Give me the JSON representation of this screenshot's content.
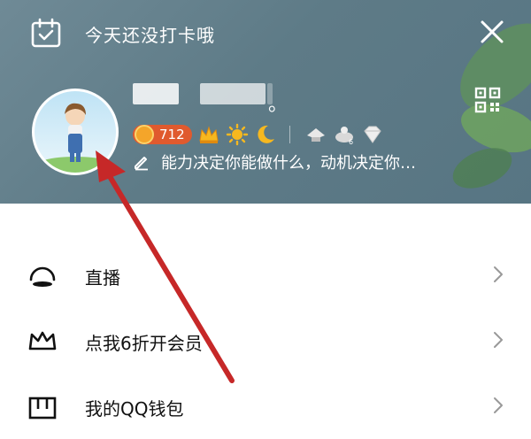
{
  "header": {
    "checkin_text": "今天还没打卡哦",
    "name_suffix": "。",
    "level": "712",
    "signature": "能力决定你能做什么，动机决定你…"
  },
  "menu": {
    "items": [
      {
        "label": "直播",
        "icon": "live-icon"
      },
      {
        "label": "点我6折开会员",
        "icon": "crown-icon"
      },
      {
        "label": "我的QQ钱包",
        "icon": "wallet-icon"
      }
    ]
  },
  "colors": {
    "header_bg": "#5e7b87",
    "level_pill": "#e05a2e",
    "arrow": "#c62828"
  }
}
